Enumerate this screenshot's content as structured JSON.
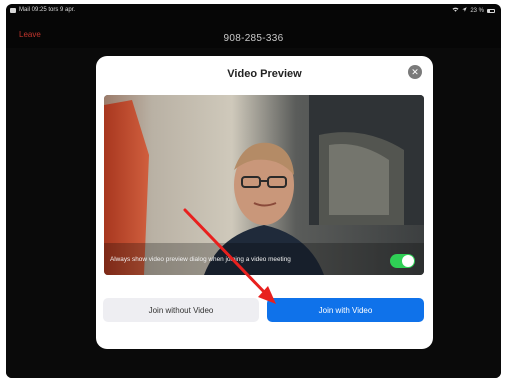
{
  "status_bar": {
    "left_text": "Mail 09:25 tors 9 apr.",
    "right_text": "23 %"
  },
  "meeting": {
    "leave_label": "Leave",
    "meeting_id": "908-285-336"
  },
  "dialog": {
    "title": "Video Preview",
    "close_icon": "close-icon",
    "always_show_label": "Always show video preview dialog when joining a video meeting",
    "always_show_enabled": true,
    "toggle_color": "#2fcf55",
    "buttons": {
      "join_without_video": "Join without Video",
      "join_with_video": "Join with Video"
    },
    "primary_color": "#0f72ea"
  },
  "annotation": {
    "icon": "red-arrow-icon",
    "color": "#e8201e"
  }
}
